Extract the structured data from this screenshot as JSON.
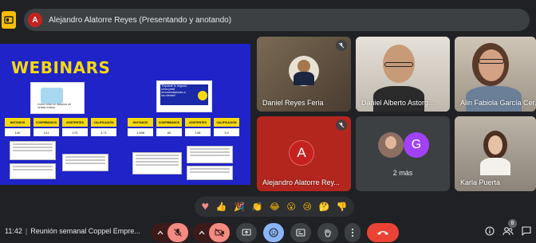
{
  "presenter_bar": {
    "avatar_letter": "A",
    "text": "Alejandro Alatorre Reyes (Presentando y anotando)"
  },
  "slide": {
    "title": "WEBINARS",
    "thumb1_text": "Cómo crear un discurso de ventas exitoso",
    "thumb2_text": "“Expande tu negocio: cómo pedir recomendaciones a los clientes”",
    "left_metrics": [
      {
        "label": "INVITADOS",
        "value": "140"
      },
      {
        "label": "CONFIRMADOS",
        "value": "101"
      },
      {
        "label": "ASISTENTES",
        "value": "170"
      },
      {
        "label": "CALIFICACIÓN",
        "value": "3.71"
      }
    ],
    "right_metrics": [
      {
        "label": "INVITADOS",
        "value": "1,598"
      },
      {
        "label": "CONFIRMADOS",
        "value": "80"
      },
      {
        "label": "ASISTENTES",
        "value": "138"
      },
      {
        "label": "CALIFICACIÓN",
        "value": "3.9"
      }
    ]
  },
  "participants": [
    {
      "name": "Daniel Reyes Feria"
    },
    {
      "name": "Daniel Alberto Astorg..."
    },
    {
      "name": "Alin Fabiola García Cer..."
    },
    {
      "name": "Alejandro Alatorre Rey...",
      "avatar_letter": "A"
    },
    {
      "name": "2 más",
      "avatar_letter": "G"
    },
    {
      "name": "Karla Puerta"
    }
  ],
  "reactions": [
    "♥",
    "👍",
    "🎉",
    "👏",
    "😂",
    "😮",
    "😢",
    "🤔",
    "👎"
  ],
  "bottom": {
    "time": "11:42",
    "meeting_title": "Reunión semanal Coppel Empre...",
    "participants_count": "8"
  },
  "colors": {
    "background": "#202124",
    "slide_blue": "#1f23c8",
    "slide_yellow": "#f6d90f",
    "hangup_red": "#ea4335",
    "tile_red": "#b3261e"
  }
}
